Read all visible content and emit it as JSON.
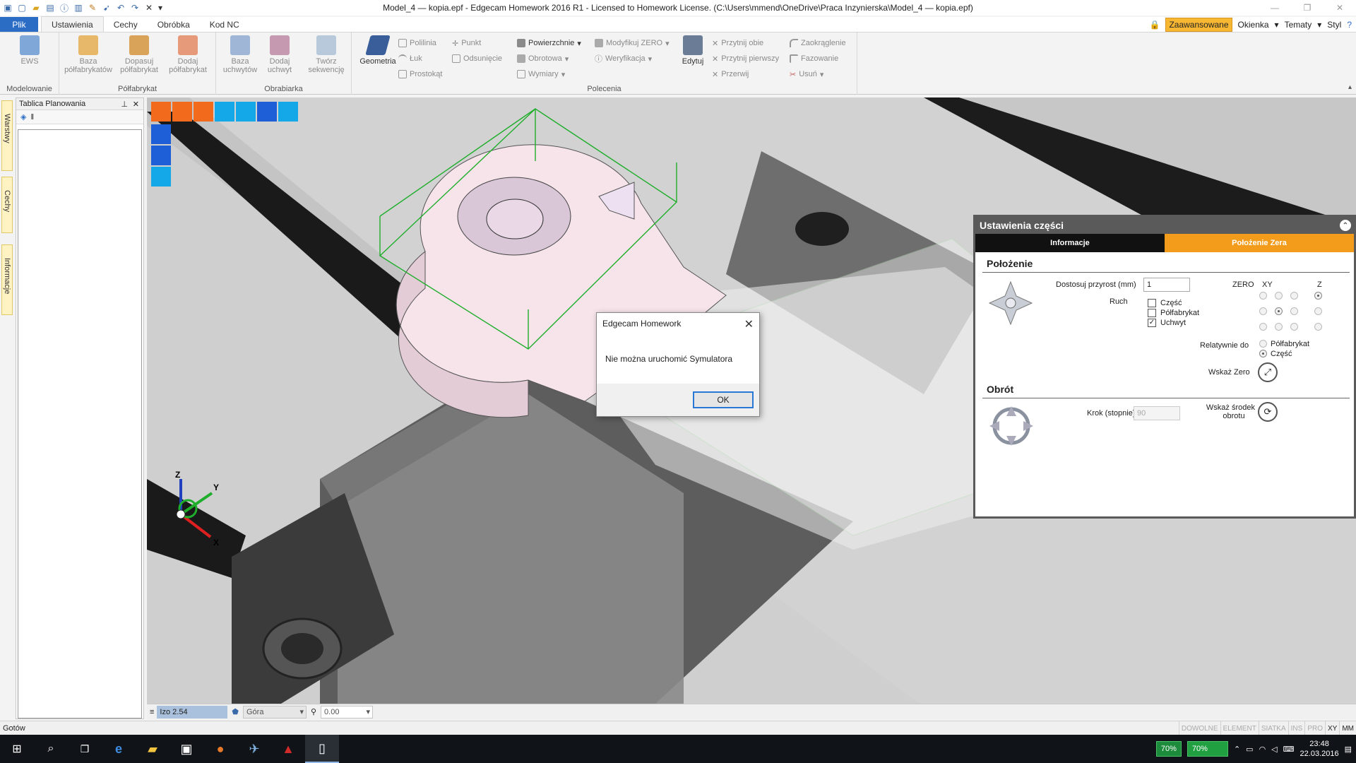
{
  "window": {
    "title": "Model_4 — kopia.epf - Edgecam Homework 2016 R1  - Licensed to Homework License. (C:\\Users\\mmend\\OneDrive\\Praca Inzynierska\\Model_4 — kopia.epf)"
  },
  "tabs": [
    "Plik",
    "Ustawienia",
    "Cechy",
    "Obróbka",
    "Kod NC"
  ],
  "tab_right": {
    "advanced": "Zaawansowane",
    "windows": "Okienka",
    "themes": "Tematy",
    "style": "Styl"
  },
  "ribbon": {
    "modeling": {
      "label": "Modelowanie",
      "ews": "EWS"
    },
    "stock": {
      "label": "Półfabrykat",
      "base_line1": "Baza",
      "base_line2": "półfabrykatów",
      "fit_line1": "Dopasuj",
      "fit_line2": "półfabrykat",
      "add_line1": "Dodaj",
      "add_line2": "półfabrykat"
    },
    "fixture": {
      "label": "Obrabiarka",
      "base_line1": "Baza",
      "base_line2": "uchwytów",
      "add_line1": "Dodaj",
      "add_line2": "uchwyt",
      "seq_line1": "Twórz",
      "seq_line2": "sekwencję"
    },
    "commands": {
      "label": "Polecenia",
      "geometry": "Geometria",
      "polyline": "Polilinia",
      "arc": "Łuk",
      "rectangle": "Prostokąt",
      "point": "Punkt",
      "offset": "Odsunięcie",
      "surfaces": "Powierzchnie",
      "rotation": "Obrotowa",
      "dimensions": "Wymiary",
      "modify_zero": "Modyfikuj ZERO",
      "verification": "Weryfikacja",
      "edit": "Edytuj",
      "trim_both": "Przytnij obie",
      "trim_first": "Przytnij pierwszy",
      "break": "Przerwij",
      "fillet": "Zaokrąglenie",
      "chamfer": "Fazowanie",
      "delete": "Usuń"
    }
  },
  "side_tabs": [
    "Warstwy",
    "Cechy",
    "Informacje"
  ],
  "planning": {
    "title": "Tablica Planowania"
  },
  "view_bar": {
    "iso": "Izo 2.54",
    "view": "Góra",
    "value": "0.00"
  },
  "status": {
    "text": "Gotów",
    "indicators": [
      "DOWOLNE",
      "ELEMENT",
      "SIATKA",
      "INS",
      "PRO",
      "XY",
      "MM"
    ]
  },
  "settings_panel": {
    "title": "Ustawienia części",
    "tab_info": "Informacje",
    "tab_zero": "Położenie Zera",
    "position_title": "Położenie",
    "increment_label": "Dostosuj przyrost (mm)",
    "increment_value": "1",
    "zero_label": "ZERO",
    "xy_label": "XY",
    "z_label": "Z",
    "move_label": "Ruch",
    "move_part": "Część",
    "move_stock": "Półfabrykat",
    "move_fixture": "Uchwyt",
    "relative_label": "Relatywnie do",
    "relative_stock": "Półfabrykat",
    "relative_part": "Część",
    "show_zero": "Wskaż Zero",
    "rotation_title": "Obrót",
    "step_label": "Krok (stopnie)",
    "step_value": "90",
    "show_center_line1": "Wskaż środek",
    "show_center_line2": "obrotu"
  },
  "dialog": {
    "title": "Edgecam Homework",
    "message": "Nie można uruchomić Symulatora",
    "ok": "OK"
  },
  "taskbar": {
    "battery1": "70%",
    "battery2": "70%",
    "time": "23:48",
    "date": "22.03.2016"
  },
  "axes": {
    "x": "X",
    "y": "Y",
    "z": "Z"
  },
  "colors": {
    "accent_blue": "#2b6cc4",
    "tab_orange": "#f39c1b",
    "panel_gray": "#5a5a5a",
    "part_pink": "#f6e4ea",
    "stock_green": "#1fae2b"
  }
}
